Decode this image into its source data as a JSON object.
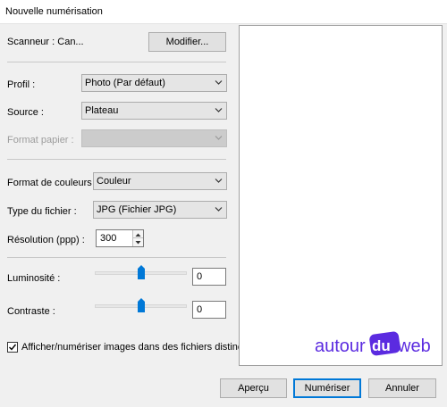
{
  "window": {
    "title": "Nouvelle numérisation"
  },
  "scanner": {
    "label": "Scanneur : Can...",
    "modify_button": "Modifier..."
  },
  "profile": {
    "label": "Profil :",
    "value": "Photo (Par défaut)"
  },
  "source": {
    "label": "Source :",
    "value": "Plateau"
  },
  "paper_format": {
    "label": "Format papier :",
    "value": ""
  },
  "color_format": {
    "label": "Format de couleurs :",
    "value": "Couleur"
  },
  "file_type": {
    "label": "Type du fichier :",
    "value": "JPG (Fichier JPG)"
  },
  "resolution": {
    "label": "Résolution (ppp) :",
    "value": "300"
  },
  "brightness": {
    "label": "Luminosité :",
    "value": "0",
    "slider_fraction": 0.5
  },
  "contrast": {
    "label": "Contraste :",
    "value": "0",
    "slider_fraction": 0.5
  },
  "separate_files": {
    "label": "Afficher/numériser images dans des fichiers distincts",
    "checked": true
  },
  "buttons": {
    "preview": "Aperçu",
    "scan": "Numériser",
    "cancel": "Annuler"
  },
  "watermark": {
    "text_left": "autour",
    "text_mid": "du",
    "text_right": "web"
  },
  "colors": {
    "accent": "#0078d7",
    "watermark_purple": "#5b2be0"
  },
  "icons": [
    "chevron-down-icon",
    "spin-up-icon",
    "spin-down-icon",
    "slider-thumb-icon",
    "checkmark-icon"
  ]
}
